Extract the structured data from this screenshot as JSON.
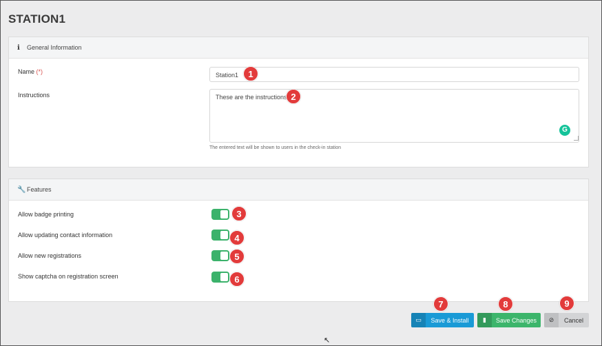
{
  "page": {
    "title": "STATION1"
  },
  "general": {
    "header": "General Information",
    "name_label": "Name",
    "required_marker": "(*)",
    "name_value": "Station1",
    "instructions_label": "Instructions",
    "instructions_value": "These are the instructions",
    "instructions_help": "The entered text will be shown to users in the check-in station"
  },
  "features": {
    "header": "Features",
    "items": [
      {
        "label": "Allow badge printing",
        "enabled": true
      },
      {
        "label": "Allow updating contact information",
        "enabled": true
      },
      {
        "label": "Allow new registrations",
        "enabled": true
      },
      {
        "label": "Show captcha on registration screen",
        "enabled": true
      }
    ]
  },
  "buttons": {
    "save_install": "Save & Install",
    "save_changes": "Save Changes",
    "cancel": "Cancel"
  },
  "callouts": [
    "1",
    "2",
    "3",
    "4",
    "5",
    "6",
    "7",
    "8",
    "9"
  ],
  "colors": {
    "toggle_on": "#3bb26b",
    "primary_blue": "#1a9ad6",
    "success_green": "#3cb56b",
    "callout_red": "#e23b3b"
  }
}
